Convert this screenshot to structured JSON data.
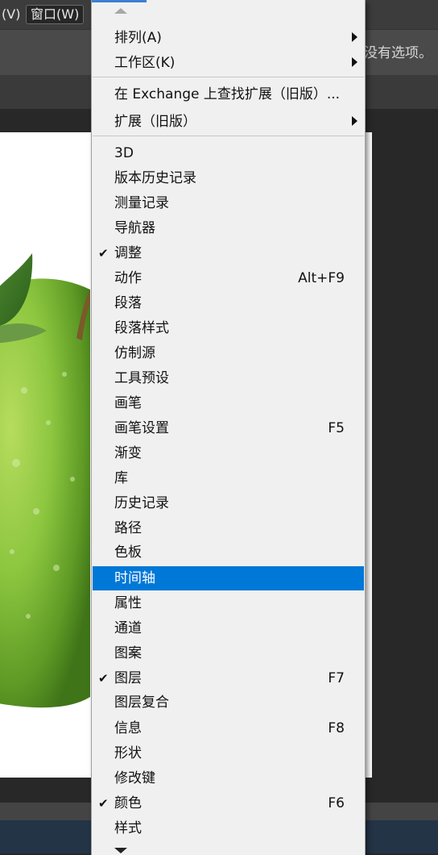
{
  "menubar": {
    "view_label": "(V)",
    "window_label": "窗口(W)"
  },
  "options_bar": {
    "no_options_text": "没有选项。"
  },
  "window_menu": {
    "sections": [
      [
        {
          "label": "排列(A)",
          "submenu": true
        },
        {
          "label": "工作区(K)",
          "submenu": true
        }
      ],
      [
        {
          "label": "在 Exchange 上查找扩展（旧版）..."
        },
        {
          "label": "扩展（旧版）",
          "submenu": true
        }
      ],
      [
        {
          "label": "3D"
        },
        {
          "label": "版本历史记录"
        },
        {
          "label": "测量记录"
        },
        {
          "label": "导航器"
        },
        {
          "label": "调整",
          "checked": true
        },
        {
          "label": "动作",
          "shortcut": "Alt+F9"
        },
        {
          "label": "段落"
        },
        {
          "label": "段落样式"
        },
        {
          "label": "仿制源"
        },
        {
          "label": "工具预设"
        },
        {
          "label": "画笔"
        },
        {
          "label": "画笔设置",
          "shortcut": "F5"
        },
        {
          "label": "渐变"
        },
        {
          "label": "库"
        },
        {
          "label": "历史记录"
        },
        {
          "label": "路径"
        },
        {
          "label": "色板"
        },
        {
          "label": "时间轴",
          "highlighted": true
        },
        {
          "label": "属性"
        },
        {
          "label": "通道"
        },
        {
          "label": "图案"
        },
        {
          "label": "图层",
          "checked": true,
          "shortcut": "F7"
        },
        {
          "label": "图层复合"
        },
        {
          "label": "信息",
          "shortcut": "F8"
        },
        {
          "label": "形状"
        },
        {
          "label": "修改键"
        },
        {
          "label": "颜色",
          "checked": true,
          "shortcut": "F6"
        },
        {
          "label": "样式"
        }
      ]
    ]
  },
  "colors": {
    "highlight": "#0078d7",
    "menu_background": "#f0f0f0"
  }
}
